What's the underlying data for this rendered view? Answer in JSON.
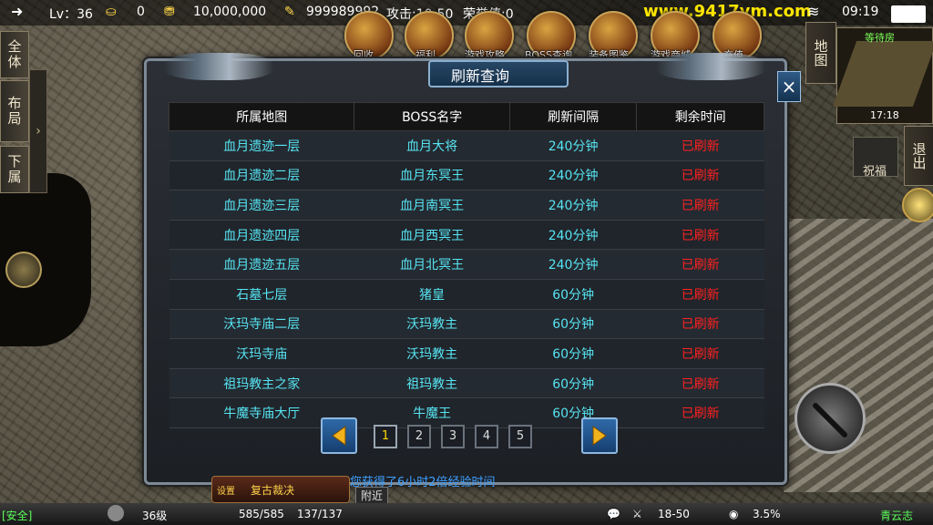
{
  "topbar": {
    "level": "Lv：36",
    "ingots": "0",
    "gold": "10,000,000",
    "yuanbao": "999989992",
    "attack": "攻击:10-50",
    "honor": "荣誉值:0",
    "site": "www.9417ym.com",
    "time": "09:19"
  },
  "menu": [
    "回收",
    "福利",
    "游戏攻略",
    "BOSS查询",
    "装备图鉴",
    "游戏商城",
    "充值"
  ],
  "side_tabs": [
    "全体",
    "布局",
    "下属"
  ],
  "right_tabs": {
    "map": "地图",
    "exit": "退出",
    "blessing": "祝福"
  },
  "minimap": {
    "name": "等待房",
    "time": "17:18"
  },
  "panel": {
    "title": "刷新查询",
    "columns": [
      "所属地图",
      "BOSS名字",
      "刷新间隔",
      "剩余时间"
    ],
    "rows": [
      {
        "map": "血月遗迹一层",
        "boss": "血月大将",
        "interval": "240分钟",
        "status": "已刷新"
      },
      {
        "map": "血月遗迹二层",
        "boss": "血月东冥王",
        "interval": "240分钟",
        "status": "已刷新"
      },
      {
        "map": "血月遗迹三层",
        "boss": "血月南冥王",
        "interval": "240分钟",
        "status": "已刷新"
      },
      {
        "map": "血月遗迹四层",
        "boss": "血月西冥王",
        "interval": "240分钟",
        "status": "已刷新"
      },
      {
        "map": "血月遗迹五层",
        "boss": "血月北冥王",
        "interval": "240分钟",
        "status": "已刷新"
      },
      {
        "map": "石墓七层",
        "boss": "猪皇",
        "interval": "60分钟",
        "status": "已刷新"
      },
      {
        "map": "沃玛寺庙二层",
        "boss": "沃玛教主",
        "interval": "60分钟",
        "status": "已刷新"
      },
      {
        "map": "沃玛寺庙",
        "boss": "沃玛教主",
        "interval": "60分钟",
        "status": "已刷新"
      },
      {
        "map": "祖玛教主之家",
        "boss": "祖玛教主",
        "interval": "60分钟",
        "status": "已刷新"
      },
      {
        "map": "牛魔寺庙大厅",
        "boss": "牛魔王",
        "interval": "60分钟",
        "status": "已刷新"
      }
    ],
    "pages": [
      "1",
      "2",
      "3",
      "4",
      "5"
    ],
    "current_page": "1",
    "close_label": "×"
  },
  "chat": {
    "message": "您获得了6小时2倍经验时间",
    "tab": "附近"
  },
  "skill": {
    "label": "复古裁决",
    "small": "设置"
  },
  "bottombar": {
    "safe": "[安全]",
    "level": "36级",
    "hp": "585/585",
    "mp": "137/137",
    "attack": "18-50",
    "exp": "3.5%",
    "server": "青云志"
  },
  "colors": {
    "accent": "#56e4f2",
    "status": "#ff2020",
    "gold": "#ffd84a"
  }
}
